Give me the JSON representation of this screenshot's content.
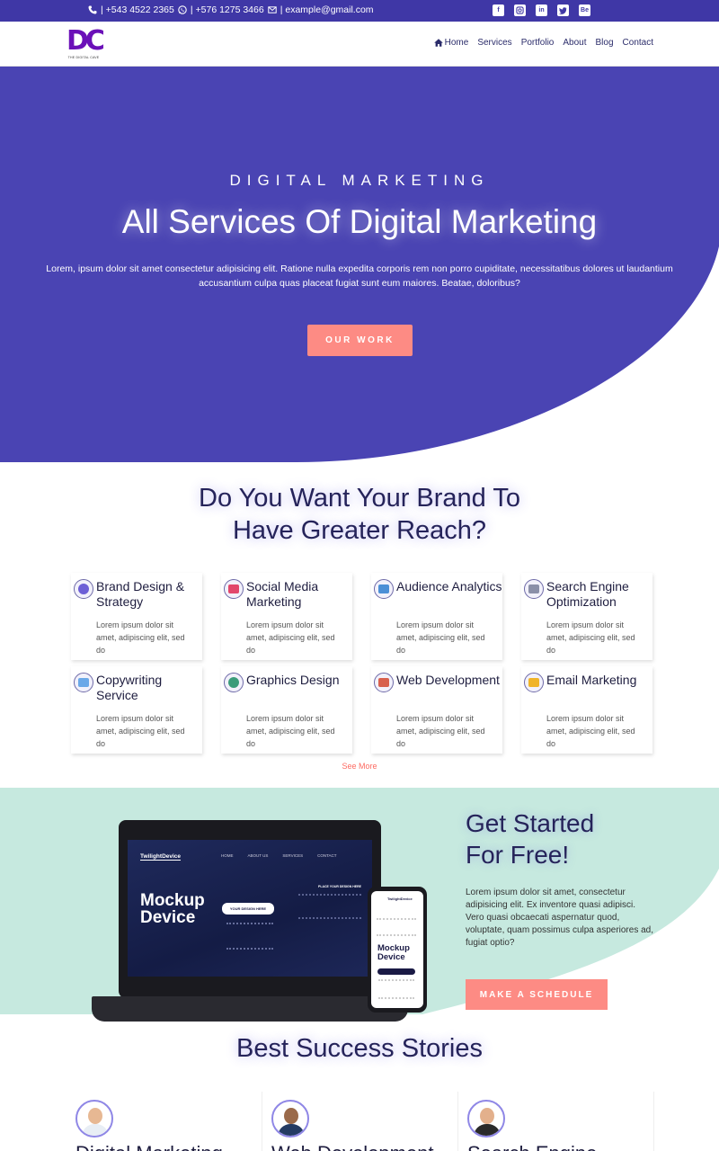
{
  "topbar": {
    "phone1": "| +543 4522 2365",
    "phone2": "| +576 1275 3466",
    "email": "| example@gmail.com",
    "socials": [
      "facebook-icon",
      "instagram-icon",
      "linkedin-icon",
      "twitter-icon",
      "behance-icon"
    ],
    "behance_label": "Be"
  },
  "logo": {
    "mark": "DC",
    "tagline": "THE DIGITAL CAVE"
  },
  "nav": {
    "items": [
      "Home",
      "Services",
      "Portfolio",
      "About",
      "Blog",
      "Contact"
    ]
  },
  "hero": {
    "eyebrow": "DIGITAL MARKETING",
    "title": "All Services Of Digital Marketing",
    "description": "Lorem, ipsum dolor sit amet consectetur adipisicing elit. Ratione nulla expedita corporis rem non porro cupiditate, necessitatibus dolores ut laudantium accusantium culpa quas placeat fugiat sunt eum maiores. Beatae, doloribus?",
    "button": "OUR WORK"
  },
  "reach": {
    "title_line1": "Do You Want Your Brand To",
    "title_line2": "Have Greater Reach?",
    "cards": [
      {
        "title": "Brand Design & Strategy",
        "text": "Lorem ipsum dolor sit amet, adipiscing elit, sed do",
        "icon": "brand-design-icon",
        "color": "#6d5fd6"
      },
      {
        "title": "Social Media Marketing",
        "text": "Lorem ipsum dolor sit amet, adipiscing elit, sed do",
        "icon": "social-media-icon",
        "color": "#e2476b"
      },
      {
        "title": "Audience Analytics",
        "text": "Lorem ipsum dolor sit amet, adipiscing elit, sed do",
        "icon": "audience-analytics-icon",
        "color": "#4b8fd6"
      },
      {
        "title": "Search Engine Optimization",
        "text": "Lorem ipsum dolor sit amet, adipiscing elit, sed do",
        "icon": "seo-icon",
        "color": "#8a8fa8"
      },
      {
        "title": "Copywriting Service",
        "text": "Lorem ipsum dolor sit amet, adipiscing elit, sed do",
        "icon": "copywriting-icon",
        "color": "#6aa8e8"
      },
      {
        "title": "Graphics Design",
        "text": "Lorem ipsum dolor sit amet, adipiscing elit, sed do",
        "icon": "graphics-design-icon",
        "color": "#3a9c7a"
      },
      {
        "title": "Web Development",
        "text": "Lorem ipsum dolor sit amet, adipiscing elit, sed do",
        "icon": "web-development-icon",
        "color": "#d8604d"
      },
      {
        "title": "Email Marketing",
        "text": "Lorem ipsum dolor sit amet, adipiscing elit, sed do",
        "icon": "email-marketing-icon",
        "color": "#f0b429"
      }
    ],
    "see_more": "See More"
  },
  "get_started": {
    "title_line1": "Get Started",
    "title_line2": "For Free!",
    "description": "Lorem ipsum dolor sit amet, consectetur adipisicing elit. Ex inventore quasi adipisci. Vero quasi obcaecati aspernatur quod, voluptate, quam possimus culpa asperiores ad, fugiat optio?",
    "button": "MAKE A SCHEDULE"
  },
  "mockup": {
    "brand": "TwilightDevice",
    "nav": [
      "HOME",
      "ABOUT US",
      "SERVICES",
      "CONTACT"
    ],
    "headline_line1": "Mockup",
    "headline_line2": "Device",
    "pill": "YOUR DESIGN HERE",
    "right_head": "PLACE YOUR DESIGN HERE"
  },
  "stories": {
    "title": "Best Success Stories",
    "items": [
      {
        "name": "Digital Marketing",
        "skin": "#e7b893",
        "shirt": "#e8eef5"
      },
      {
        "name": "Web Development",
        "skin": "#9a6a4a",
        "shirt": "#243b63"
      },
      {
        "name": "Search Engine",
        "skin": "#e3b08c",
        "shirt": "#2a2a2a"
      }
    ]
  },
  "colors": {
    "primary": "#4a44b3",
    "topbar": "#3f37a6",
    "accent": "#fd8b84",
    "mint": "#c6e9df"
  }
}
